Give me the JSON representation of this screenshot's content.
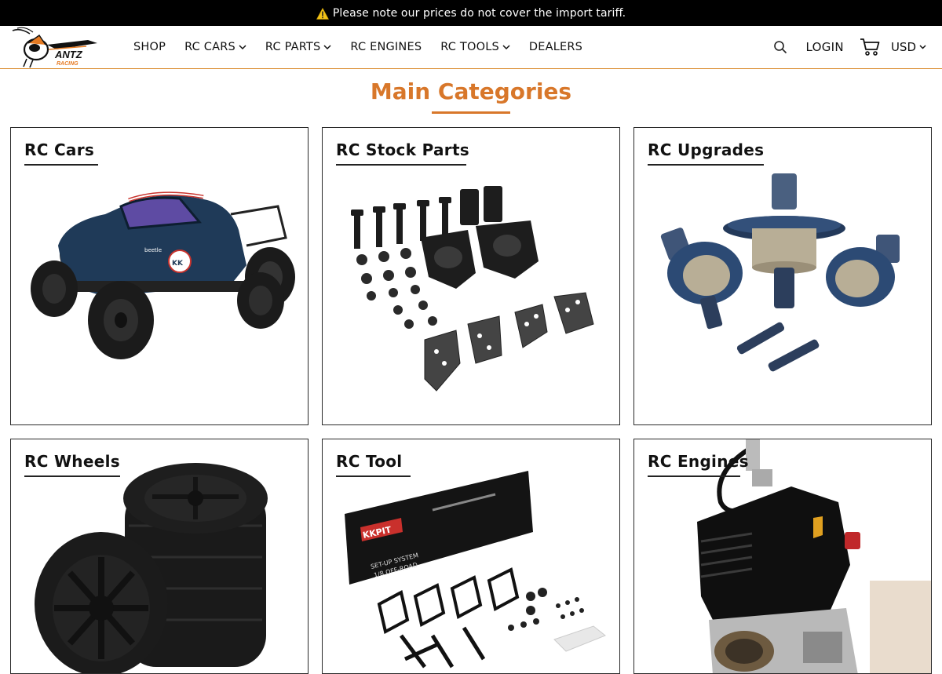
{
  "announcement": {
    "text": "Please note our prices do not cover the import tariff."
  },
  "brand": {
    "logo_text": "ANTZ",
    "logo_subtext": "RACING",
    "accent": "#d8772a"
  },
  "nav": {
    "items": [
      {
        "label": "SHOP",
        "dropdown": false
      },
      {
        "label": "RC CARS",
        "dropdown": true
      },
      {
        "label": "RC PARTS",
        "dropdown": true
      },
      {
        "label": "RC ENGINES",
        "dropdown": false
      },
      {
        "label": "RC TOOLS",
        "dropdown": true
      },
      {
        "label": "DEALERS",
        "dropdown": false
      }
    ]
  },
  "tools": {
    "login_label": "LOGIN",
    "currency": "USD",
    "search_icon": "search-icon",
    "cart_icon": "cart-icon"
  },
  "main": {
    "title": "Main Categories",
    "categories": [
      {
        "label": "RC Cars",
        "image": "rc-car-photo"
      },
      {
        "label": "RC Stock Parts",
        "image": "rc-parts-photo"
      },
      {
        "label": "RC Upgrades",
        "image": "differential-photo"
      },
      {
        "label": "RC Wheels",
        "image": "wheels-photo"
      },
      {
        "label": "RC Tool",
        "image": "setup-tool-photo"
      },
      {
        "label": "RC Engines",
        "image": "engine-photo"
      }
    ]
  }
}
